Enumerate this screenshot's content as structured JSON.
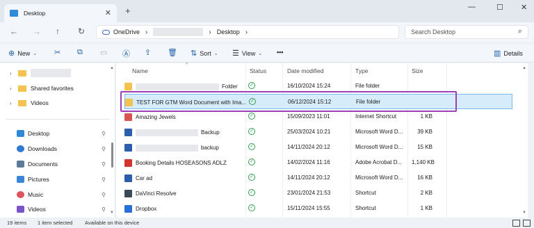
{
  "tab": {
    "title": "Desktop",
    "close": "✕",
    "new": "+"
  },
  "window": {
    "minimize": "—",
    "maximize": "☐",
    "close": "✕"
  },
  "nav": {
    "back": "←",
    "forward": "→",
    "up": "↑",
    "refresh": "↻"
  },
  "address": {
    "root": "OneDrive",
    "sep1": "›",
    "sep2": "›",
    "current": "Desktop",
    "sep3": "›"
  },
  "search": {
    "placeholder": "Search Desktop",
    "icon": "⌕"
  },
  "toolbar": {
    "new_label": "New",
    "sort_label": "Sort",
    "view_label": "View",
    "more": "•••",
    "details_label": "Details"
  },
  "sidebar": {
    "tree": [
      {
        "label": "",
        "expand": "›"
      },
      {
        "label": "Shared favorites",
        "expand": "›"
      },
      {
        "label": "Videos",
        "expand": "›"
      }
    ],
    "quick": [
      {
        "label": "Desktop",
        "icon_color": "#2f8ad8"
      },
      {
        "label": "Downloads",
        "icon_color": "#2f7ad1"
      },
      {
        "label": "Documents",
        "icon_color": "#5d7a9a"
      },
      {
        "label": "Pictures",
        "icon_color": "#3a86d6"
      },
      {
        "label": "Music",
        "icon_color": "#e0525c"
      },
      {
        "label": "Videos",
        "icon_color": "#7a53c9"
      }
    ],
    "pin": "📌"
  },
  "columns": {
    "name": "Name",
    "status": "Status",
    "date": "Date modified",
    "type": "Type",
    "size": "Size"
  },
  "files": [
    {
      "name": "Folder",
      "date": "16/10/2024 15:24",
      "type": "File folder",
      "size": "",
      "icon": "folder",
      "icon_color": "#f3c24f",
      "redacted": true
    },
    {
      "name": "TEST FOR GTM Word Document with Ima...",
      "date": "06/12/2024 15:12",
      "type": "File folder",
      "size": "",
      "icon": "folder",
      "icon_color": "#f3c24f",
      "selected": true
    },
    {
      "name": "Amazing Jewels",
      "date": "15/09/2023 11:01",
      "type": "Internet Shortcut",
      "size": "1 KB",
      "icon": "shortcut",
      "icon_color": "#d9534f"
    },
    {
      "name": "Backup",
      "date": "25/03/2024 10:21",
      "type": "Microsoft Word D...",
      "size": "39 KB",
      "icon": "word",
      "icon_color": "#2b5fad",
      "redacted": true
    },
    {
      "name": "backup",
      "date": "14/11/2024 20:12",
      "type": "Microsoft Word D...",
      "size": "15 KB",
      "icon": "word",
      "icon_color": "#2b5fad",
      "redacted": true
    },
    {
      "name": "Booking Details HOSEASONS ADLZ",
      "date": "14/02/2024 11:16",
      "type": "Adobe Acrobat D...",
      "size": "1,140 KB",
      "icon": "pdf",
      "icon_color": "#d3342f"
    },
    {
      "name": "Car ad",
      "date": "14/11/2024 20:12",
      "type": "Microsoft Word D...",
      "size": "16 KB",
      "icon": "word",
      "icon_color": "#2b5fad"
    },
    {
      "name": "DaVinci Resolve",
      "date": "23/01/2024 21:53",
      "type": "Shortcut",
      "size": "2 KB",
      "icon": "app",
      "icon_color": "#3a4a5a"
    },
    {
      "name": "Dropbox",
      "date": "15/11/2024 15:55",
      "type": "Shortcut",
      "size": "1 KB",
      "icon": "app",
      "icon_color": "#2a6fd6"
    }
  ],
  "status_icon": "✓",
  "statusbar": {
    "items": "19 items",
    "selected": "1 item selected",
    "availability": "Available on this device"
  }
}
